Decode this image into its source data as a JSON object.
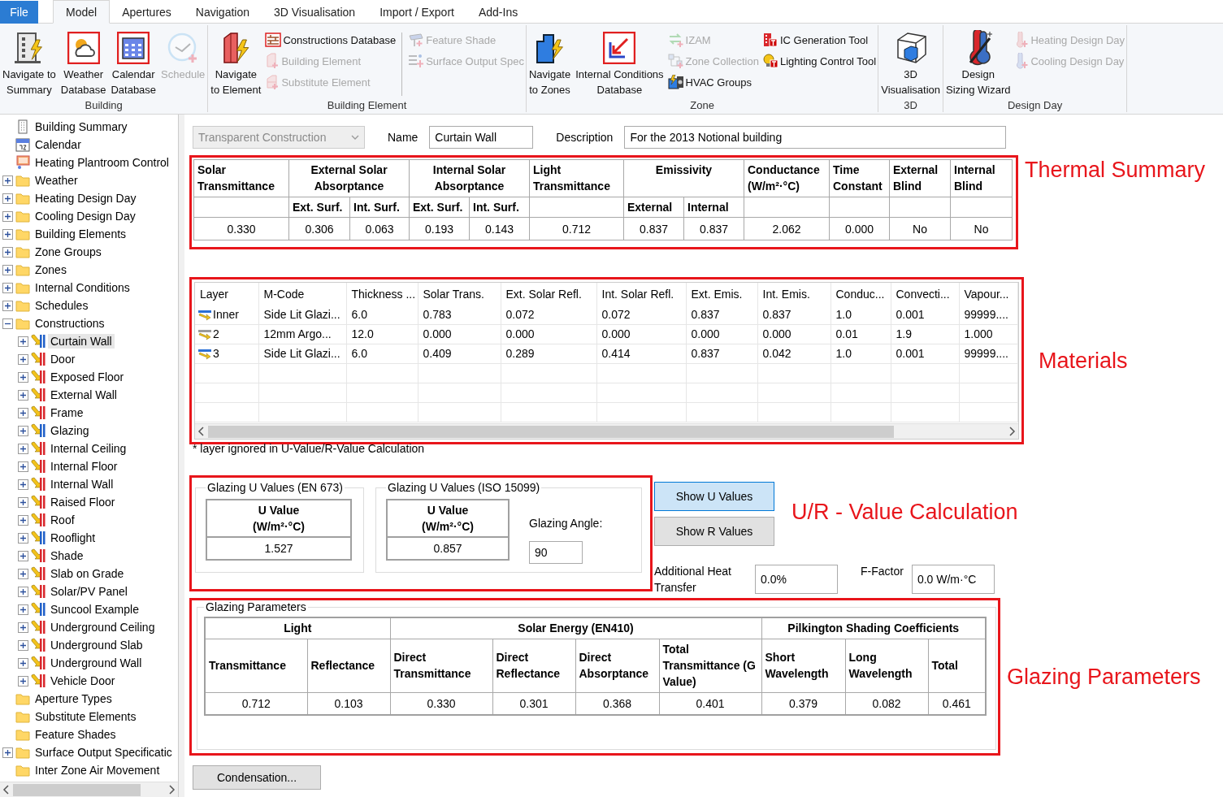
{
  "menu_tabs": [
    {
      "label": "File",
      "kind": "file",
      "selected": false
    },
    {
      "label": "Model",
      "kind": "tab",
      "selected": true
    },
    {
      "label": "Apertures",
      "kind": "tab",
      "selected": false
    },
    {
      "label": "Navigation",
      "kind": "tab",
      "selected": false
    },
    {
      "label": "3D Visualisation",
      "kind": "tab",
      "selected": false
    },
    {
      "label": "Import / Export",
      "kind": "tab",
      "selected": false
    },
    {
      "label": "Add-Ins",
      "kind": "tab",
      "selected": false
    }
  ],
  "ribbon": [
    {
      "title": "Building",
      "items": [
        {
          "kind": "large",
          "label": "Navigate to\nSummary",
          "disabled": false
        },
        {
          "kind": "large",
          "label": "Weather\nDatabase",
          "disabled": false
        },
        {
          "kind": "large",
          "label": "Calendar\nDatabase",
          "disabled": false
        },
        {
          "kind": "large",
          "label": "Schedule",
          "disabled": true
        }
      ]
    },
    {
      "title": "Building Element",
      "items": [
        {
          "kind": "large",
          "label": "Navigate\nto Element",
          "disabled": false
        },
        {
          "kind": "column",
          "items": [
            {
              "label": "Constructions Database",
              "disabled": false
            },
            {
              "label": "Building Element",
              "disabled": true
            },
            {
              "label": "Substitute Element",
              "disabled": true
            }
          ]
        },
        {
          "kind": "separator"
        },
        {
          "kind": "column",
          "items": [
            {
              "label": "Feature Shade",
              "disabled": true
            },
            {
              "label": "Surface Output Spec",
              "disabled": true
            }
          ]
        }
      ]
    },
    {
      "title": "Zone",
      "items": [
        {
          "kind": "large",
          "label": "Navigate\nto Zones",
          "disabled": false
        },
        {
          "kind": "large",
          "label": "Internal Conditions\nDatabase",
          "disabled": false
        },
        {
          "kind": "column",
          "items": [
            {
              "label": "IZAM",
              "disabled": true
            },
            {
              "label": "Zone Collection",
              "disabled": true
            },
            {
              "label": "HVAC Groups",
              "disabled": false
            }
          ]
        },
        {
          "kind": "column",
          "items": [
            {
              "label": "IC Generation Tool",
              "disabled": false
            },
            {
              "label": "Lighting Control Tool",
              "disabled": false
            }
          ]
        }
      ]
    },
    {
      "title": "3D",
      "items": [
        {
          "kind": "large",
          "label": "3D\nVisualisation",
          "disabled": false
        }
      ]
    },
    {
      "title": "Design Day",
      "items": [
        {
          "kind": "large",
          "label": "Design\nSizing Wizard",
          "disabled": false
        },
        {
          "kind": "column",
          "items": [
            {
              "label": "Heating Design Day",
              "disabled": true
            },
            {
              "label": "Cooling Design Day",
              "disabled": true
            }
          ]
        }
      ]
    }
  ],
  "tree": [
    {
      "label": "Building Summary",
      "kind": "document",
      "selected": false
    },
    {
      "label": "Calendar",
      "kind": "document",
      "selected": false
    },
    {
      "label": "Heating Plantroom Control",
      "kind": "document",
      "selected": false
    },
    {
      "label": "Weather",
      "kind": "folder",
      "expanded": false,
      "selected": false
    },
    {
      "label": "Heating Design Day",
      "kind": "folder",
      "expanded": false,
      "selected": false
    },
    {
      "label": "Cooling Design Day",
      "kind": "folder",
      "expanded": false,
      "selected": false
    },
    {
      "label": "Building Elements",
      "kind": "folder",
      "expanded": false,
      "selected": false
    },
    {
      "label": "Zone Groups",
      "kind": "folder",
      "expanded": false,
      "selected": false
    },
    {
      "label": "Zones",
      "kind": "folder",
      "expanded": false,
      "selected": false
    },
    {
      "label": "Internal Conditions",
      "kind": "folder",
      "expanded": false,
      "selected": false
    },
    {
      "label": "Schedules",
      "kind": "folder",
      "expanded": false,
      "selected": false
    },
    {
      "label": "Constructions",
      "kind": "folder",
      "expanded": true,
      "selected": false,
      "children": [
        {
          "label": "Curtain Wall",
          "kind": "construction",
          "color": "#1f5fc8",
          "expanded": false,
          "selected": true
        },
        {
          "label": "Door",
          "kind": "construction",
          "color": "#d9262b",
          "expanded": false,
          "selected": false
        },
        {
          "label": "Exposed Floor",
          "kind": "construction",
          "color": "#d9262b",
          "expanded": false,
          "selected": false
        },
        {
          "label": "External Wall",
          "kind": "construction",
          "color": "#d9262b",
          "expanded": false,
          "selected": false
        },
        {
          "label": "Frame",
          "kind": "construction",
          "color": "#d9262b",
          "expanded": false,
          "selected": false
        },
        {
          "label": "Glazing",
          "kind": "construction",
          "color": "#1f5fc8",
          "expanded": false,
          "selected": false
        },
        {
          "label": "Internal Ceiling",
          "kind": "construction",
          "color": "#d9262b",
          "expanded": false,
          "selected": false
        },
        {
          "label": "Internal Floor",
          "kind": "construction",
          "color": "#d9262b",
          "expanded": false,
          "selected": false
        },
        {
          "label": "Internal Wall",
          "kind": "construction",
          "color": "#d9262b",
          "expanded": false,
          "selected": false
        },
        {
          "label": "Raised Floor",
          "kind": "construction",
          "color": "#d9262b",
          "expanded": false,
          "selected": false
        },
        {
          "label": "Roof",
          "kind": "construction",
          "color": "#d9262b",
          "expanded": false,
          "selected": false
        },
        {
          "label": "Rooflight",
          "kind": "construction",
          "color": "#1f5fc8",
          "expanded": false,
          "selected": false
        },
        {
          "label": "Shade",
          "kind": "construction",
          "color": "#d9262b",
          "expanded": false,
          "selected": false
        },
        {
          "label": "Slab on Grade",
          "kind": "construction",
          "color": "#d9262b",
          "expanded": false,
          "selected": false
        },
        {
          "label": "Solar/PV Panel",
          "kind": "construction",
          "color": "#d9262b",
          "expanded": false,
          "selected": false
        },
        {
          "label": "Suncool Example",
          "kind": "construction",
          "color": "#1f5fc8",
          "expanded": false,
          "selected": false
        },
        {
          "label": "Underground Ceiling",
          "kind": "construction",
          "color": "#d9262b",
          "expanded": false,
          "selected": false
        },
        {
          "label": "Underground Slab",
          "kind": "construction",
          "color": "#d9262b",
          "expanded": false,
          "selected": false
        },
        {
          "label": "Underground Wall",
          "kind": "construction",
          "color": "#d9262b",
          "expanded": false,
          "selected": false
        },
        {
          "label": "Vehicle Door",
          "kind": "construction",
          "color": "#d9262b",
          "expanded": false,
          "selected": false
        }
      ]
    },
    {
      "label": "Aperture Types",
      "kind": "folder",
      "selected": false
    },
    {
      "label": "Substitute Elements",
      "kind": "folder",
      "selected": false
    },
    {
      "label": "Feature Shades",
      "kind": "folder",
      "selected": false
    },
    {
      "label": "Surface Output Specificatic",
      "kind": "folder",
      "expanded": false,
      "selected": false
    },
    {
      "label": "Inter Zone Air Movement",
      "kind": "folder",
      "selected": false
    }
  ],
  "form": {
    "type": "Transparent Construction",
    "type_disabled": true,
    "name_label": "Name",
    "name": "Curtain Wall",
    "description_label": "Description",
    "description": "For the 2013 Notional building"
  },
  "thermal_summary": {
    "callout": "Thermal Summary",
    "columns": [
      {
        "label": "Solar Transmittance"
      },
      {
        "label": "External Solar Absorptance",
        "sub": [
          "Ext. Surf.",
          "Int. Surf."
        ]
      },
      {
        "label": "Internal Solar Absorptance",
        "sub": [
          "Ext. Surf.",
          "Int. Surf."
        ]
      },
      {
        "label": "Light Transmittance"
      },
      {
        "label": "Emissivity",
        "sub": [
          "External",
          "Internal"
        ]
      },
      {
        "label": "Conductance (W/m²·°C)"
      },
      {
        "label": "Time Constant"
      },
      {
        "label": "External Blind"
      },
      {
        "label": "Internal Blind"
      }
    ],
    "values": [
      "0.330",
      "0.306",
      "0.063",
      "0.193",
      "0.143",
      "0.712",
      "0.837",
      "0.837",
      "2.062",
      "0.000",
      "No",
      "No"
    ]
  },
  "materials": {
    "callout": "Materials",
    "columns": [
      "Layer",
      "M-Code",
      "Thickness ...",
      "Solar Trans.",
      "Ext. Solar Refl.",
      "Int. Solar Refl.",
      "Ext. Emis.",
      "Int. Emis.",
      "Conduc...",
      "Convecti...",
      "Vapour..."
    ],
    "rows": [
      {
        "color": "#2a6fd6",
        "cells": [
          "Inner",
          "Side Lit Glazi...",
          "6.0",
          "0.783",
          "0.072",
          "0.072",
          "0.837",
          "0.837",
          "1.0",
          "0.001",
          "99999...."
        ]
      },
      {
        "color": "#9a9a9a",
        "cells": [
          "2",
          "12mm Argo...",
          "12.0",
          "0.000",
          "0.000",
          "0.000",
          "0.000",
          "0.000",
          "0.01",
          "1.9",
          "1.000"
        ]
      },
      {
        "color": "#2a6fd6",
        "cells": [
          "3",
          "Side Lit Glazi...",
          "6.0",
          "0.409",
          "0.289",
          "0.414",
          "0.837",
          "0.042",
          "1.0",
          "0.001",
          "99999...."
        ]
      }
    ],
    "footnote": "* layer ignored in U-Value/R-Value Calculation"
  },
  "u_values": {
    "callout": "U/R - Value Calculation",
    "groups": [
      {
        "title": "Glazing U Values (EN 673)",
        "header": "U Value\n(W/m²·°C)",
        "value": "1.527"
      },
      {
        "title": "Glazing U Values (ISO 15099)",
        "header": "U Value\n(W/m²·°C)",
        "value": "0.857",
        "angle_label": "Glazing Angle:",
        "angle": "90"
      }
    ],
    "buttons": [
      {
        "label": "Show U Values",
        "selected": true
      },
      {
        "label": "Show R Values",
        "selected": false
      }
    ],
    "additional_heat_label": "Additional Heat Transfer",
    "additional_heat": "0.0%",
    "f_factor_label": "F-Factor",
    "f_factor": "0.0 W/m·°C"
  },
  "glazing_parameters": {
    "callout": "Glazing Parameters",
    "title": "Glazing Parameters",
    "groups": [
      {
        "label": "Light",
        "columns": [
          "Transmittance",
          "Reflectance"
        ]
      },
      {
        "label": "Solar Energy (EN410)",
        "columns": [
          "Direct Transmittance",
          "Direct Reflectance",
          "Direct Absorptance",
          "Total Transmittance (G Value)"
        ]
      },
      {
        "label": "Pilkington Shading Coefficients",
        "columns": [
          "Short Wavelength",
          "Long Wavelength",
          "Total"
        ]
      }
    ],
    "values": [
      "0.712",
      "0.103",
      "0.330",
      "0.301",
      "0.368",
      "0.401",
      "0.379",
      "0.082",
      "0.461"
    ]
  },
  "condensation_button": "Condensation..."
}
